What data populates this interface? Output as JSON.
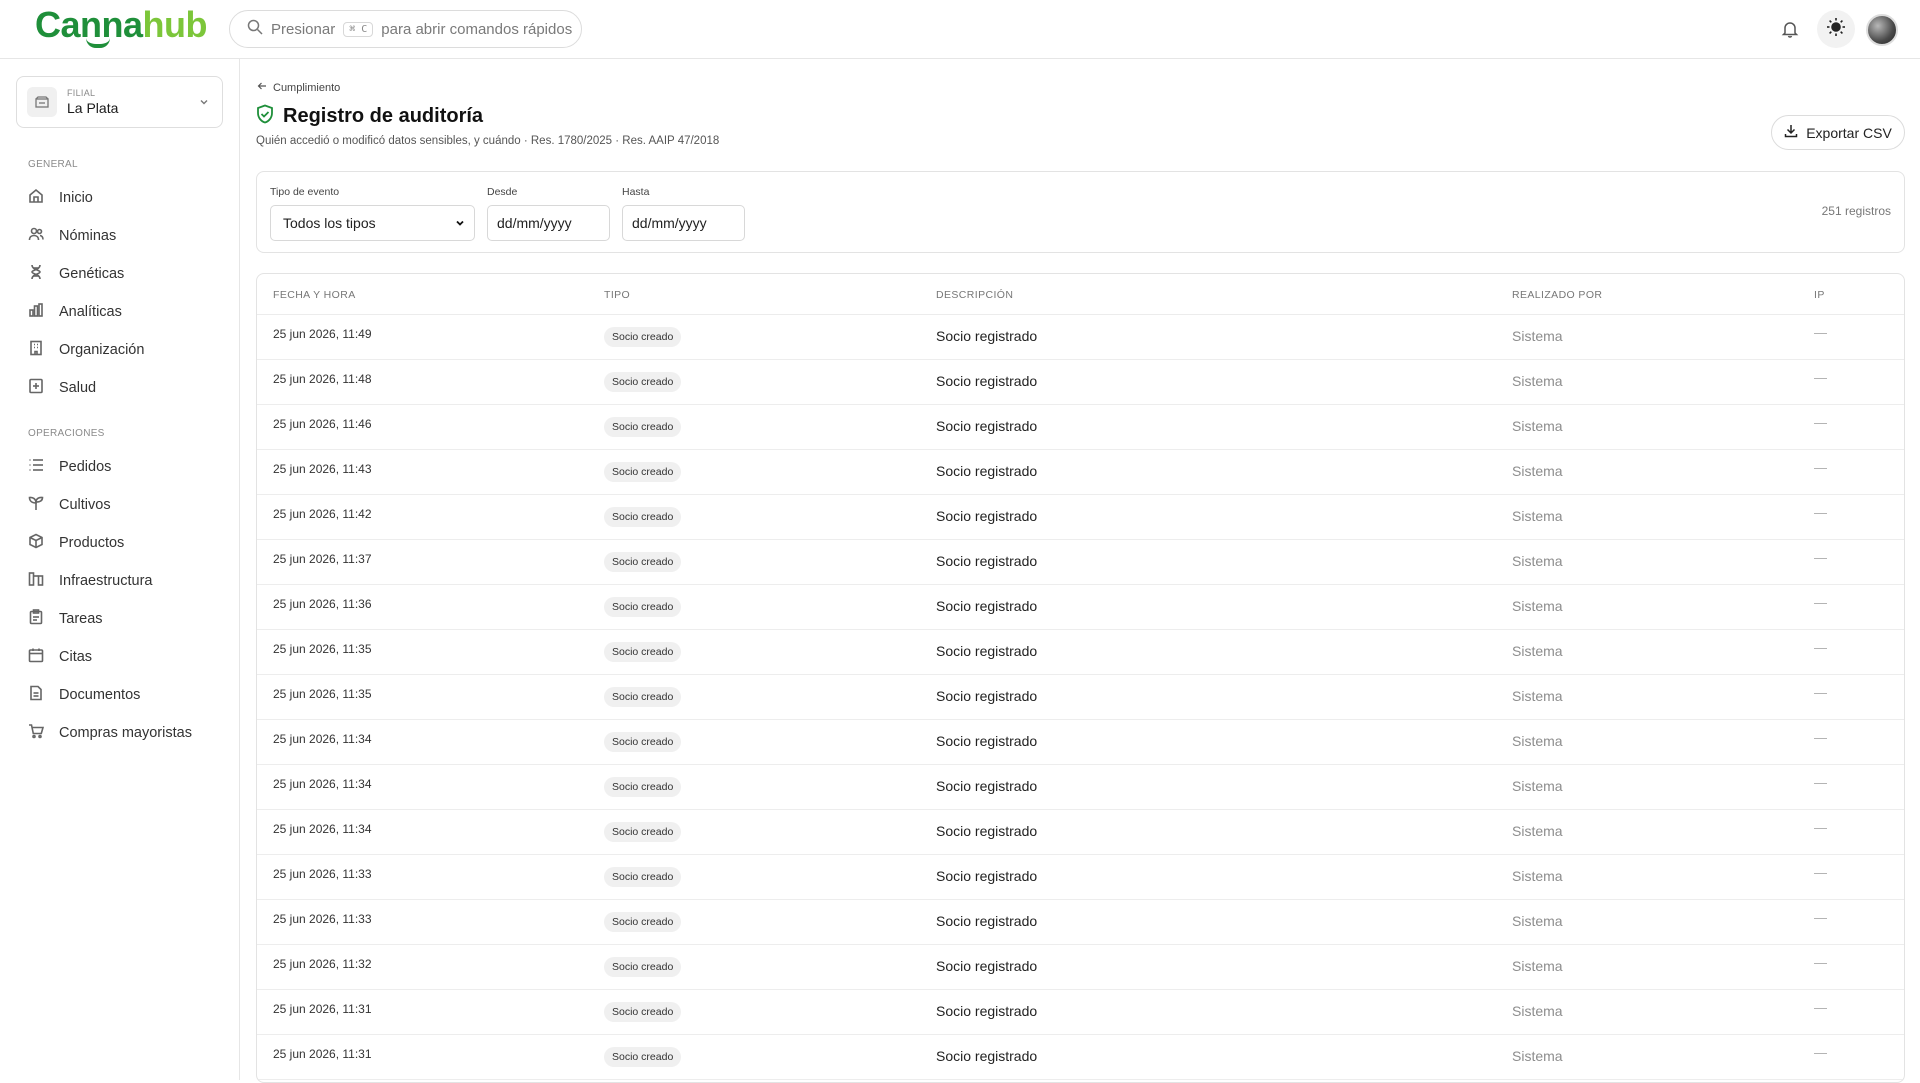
{
  "brand": {
    "part1": "Canna",
    "part2": "hub",
    "color_primary": "#1f8f3a",
    "color_secondary": "#7cc63a"
  },
  "search": {
    "prefix": "Presionar",
    "shortcut": "⌘ C",
    "suffix": "para abrir comandos rápidos"
  },
  "header_icons": [
    "bell-icon",
    "sun-icon",
    "avatar"
  ],
  "branch": {
    "label": "FILIAL",
    "name": "La Plata"
  },
  "sidebar": {
    "general_label": "GENERAL",
    "general_items": [
      {
        "label": "Inicio",
        "icon": "home-icon"
      },
      {
        "label": "Nóminas",
        "icon": "users-icon"
      },
      {
        "label": "Genéticas",
        "icon": "dna-icon"
      },
      {
        "label": "Analíticas",
        "icon": "bar-chart-icon"
      },
      {
        "label": "Organización",
        "icon": "building-icon"
      },
      {
        "label": "Salud",
        "icon": "health-icon"
      }
    ],
    "operations_label": "OPERACIONES",
    "operations_items": [
      {
        "label": "Pedidos",
        "icon": "list-icon"
      },
      {
        "label": "Cultivos",
        "icon": "sprout-icon"
      },
      {
        "label": "Productos",
        "icon": "box-icon"
      },
      {
        "label": "Infraestructura",
        "icon": "infrastructure-icon"
      },
      {
        "label": "Tareas",
        "icon": "clipboard-icon"
      },
      {
        "label": "Citas",
        "icon": "calendar-icon"
      },
      {
        "label": "Documentos",
        "icon": "document-icon"
      },
      {
        "label": "Compras mayoristas",
        "icon": "cart-icon"
      }
    ]
  },
  "page": {
    "breadcrumb": "Cumplimiento",
    "title": "Registro de auditoría",
    "subtitle": "Quién accedió o modificó datos sensibles, y cuándo · Res. 1780/2025 · Res. AAIP 47/2018",
    "export_label": "Exportar CSV"
  },
  "filters": {
    "type_label": "Tipo de evento",
    "type_value": "Todos los tipos",
    "from_label": "Desde",
    "from_value": "dd/mm/yyyy",
    "to_label": "Hasta",
    "to_value": "dd/mm/yyyy",
    "records": "251 registros"
  },
  "table": {
    "headers": [
      "FECHA Y HORA",
      "TIPO",
      "DESCRIPCIÓN",
      "REALIZADO POR",
      "IP"
    ],
    "rows": [
      {
        "date": "25 jun 2026, 11:49",
        "type": "Socio creado",
        "desc": "Socio registrado",
        "by": "Sistema",
        "ip": "—"
      },
      {
        "date": "25 jun 2026, 11:48",
        "type": "Socio creado",
        "desc": "Socio registrado",
        "by": "Sistema",
        "ip": "—"
      },
      {
        "date": "25 jun 2026, 11:46",
        "type": "Socio creado",
        "desc": "Socio registrado",
        "by": "Sistema",
        "ip": "—"
      },
      {
        "date": "25 jun 2026, 11:43",
        "type": "Socio creado",
        "desc": "Socio registrado",
        "by": "Sistema",
        "ip": "—"
      },
      {
        "date": "25 jun 2026, 11:42",
        "type": "Socio creado",
        "desc": "Socio registrado",
        "by": "Sistema",
        "ip": "—"
      },
      {
        "date": "25 jun 2026, 11:37",
        "type": "Socio creado",
        "desc": "Socio registrado",
        "by": "Sistema",
        "ip": "—"
      },
      {
        "date": "25 jun 2026, 11:36",
        "type": "Socio creado",
        "desc": "Socio registrado",
        "by": "Sistema",
        "ip": "—"
      },
      {
        "date": "25 jun 2026, 11:35",
        "type": "Socio creado",
        "desc": "Socio registrado",
        "by": "Sistema",
        "ip": "—"
      },
      {
        "date": "25 jun 2026, 11:35",
        "type": "Socio creado",
        "desc": "Socio registrado",
        "by": "Sistema",
        "ip": "—"
      },
      {
        "date": "25 jun 2026, 11:34",
        "type": "Socio creado",
        "desc": "Socio registrado",
        "by": "Sistema",
        "ip": "—"
      },
      {
        "date": "25 jun 2026, 11:34",
        "type": "Socio creado",
        "desc": "Socio registrado",
        "by": "Sistema",
        "ip": "—"
      },
      {
        "date": "25 jun 2026, 11:34",
        "type": "Socio creado",
        "desc": "Socio registrado",
        "by": "Sistema",
        "ip": "—"
      },
      {
        "date": "25 jun 2026, 11:33",
        "type": "Socio creado",
        "desc": "Socio registrado",
        "by": "Sistema",
        "ip": "—"
      },
      {
        "date": "25 jun 2026, 11:33",
        "type": "Socio creado",
        "desc": "Socio registrado",
        "by": "Sistema",
        "ip": "—"
      },
      {
        "date": "25 jun 2026, 11:32",
        "type": "Socio creado",
        "desc": "Socio registrado",
        "by": "Sistema",
        "ip": "—"
      },
      {
        "date": "25 jun 2026, 11:31",
        "type": "Socio creado",
        "desc": "Socio registrado",
        "by": "Sistema",
        "ip": "—"
      },
      {
        "date": "25 jun 2026, 11:31",
        "type": "Socio creado",
        "desc": "Socio registrado",
        "by": "Sistema",
        "ip": "—"
      }
    ]
  }
}
